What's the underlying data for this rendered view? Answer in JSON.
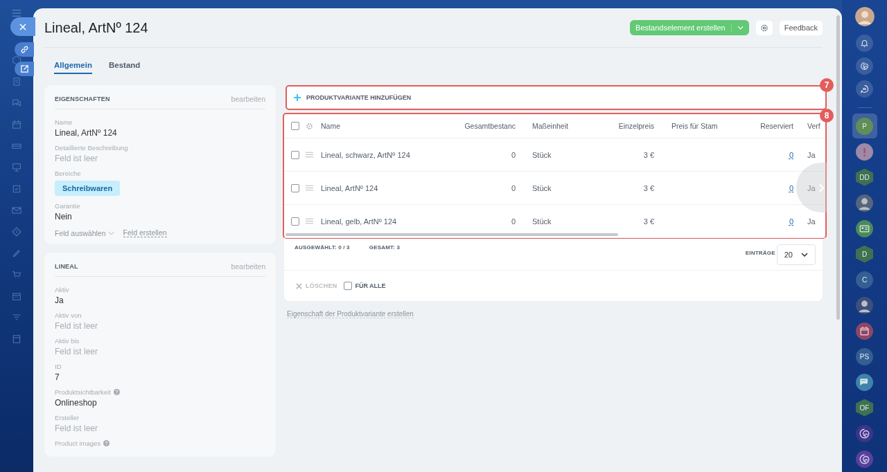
{
  "title": "Lineal, ArtNº 124",
  "header_buttons": {
    "create": "Bestandselement erstellen",
    "feedback": "Feedback"
  },
  "tabs": [
    {
      "label": "Allgemein",
      "selected": true
    },
    {
      "label": "Bestand",
      "selected": false
    }
  ],
  "cards": [
    {
      "title": "EIGENSCHAFTEN",
      "action": "bearbeiten",
      "fields": [
        {
          "label": "Name",
          "value": "Lineal, ArtNº 124",
          "empty": false
        },
        {
          "label": "Detaillierte Beschreibung",
          "value": "Feld ist leer",
          "empty": true
        },
        {
          "label": "Bereiche",
          "tag": "Schreibwaren"
        },
        {
          "label": "Garantie",
          "value": "Nein",
          "empty": false
        }
      ],
      "footer": {
        "select": "Feld auswählen",
        "create": "Feld erstellen"
      }
    },
    {
      "title": "LINEAL",
      "action": "bearbeiten",
      "fields": [
        {
          "label": "Aktiv",
          "value": "Ja",
          "empty": false
        },
        {
          "label": "Aktiv von",
          "value": "Feld ist leer",
          "empty": true
        },
        {
          "label": "Aktiv bis",
          "value": "Feld ist leer",
          "empty": true
        },
        {
          "label": "ID",
          "value": "7",
          "empty": false
        },
        {
          "label": "Produktsichtbarkeit",
          "value": "Onlineshop",
          "empty": false,
          "help": true
        },
        {
          "label": "Ersteller",
          "value": "Feld ist leer",
          "empty": true
        },
        {
          "label": "Product images",
          "help": true
        }
      ]
    }
  ],
  "add_variant": {
    "label": "PRODUKTVARIANTE HINZUFÜGEN",
    "marker": "7"
  },
  "table": {
    "marker": "8",
    "all_checked": false,
    "columns": [
      "Name",
      "Gesamtbestanc",
      "Maßeinheit",
      "Einzelpreis",
      "Preis für Stam",
      "Reserviert",
      "Verf"
    ],
    "rows": [
      {
        "checked": false,
        "cells": [
          "Lineal, schwarz, ArtNº 124",
          "0",
          "Stück",
          "3 €",
          "",
          "0",
          "Ja"
        ]
      },
      {
        "checked": false,
        "cells": [
          "Lineal, ArtNº 124",
          "0",
          "Stück",
          "3 €",
          "",
          "0",
          "Ja"
        ]
      },
      {
        "checked": false,
        "cells": [
          "Lineal, gelb, ArtNº 124",
          "0",
          "Stück",
          "3 €",
          "",
          "0",
          "Ja"
        ]
      }
    ]
  },
  "footer": {
    "selected": "AUSGEWÄHLT: **0 / 3**",
    "total": "GESAMT: **3**",
    "entries_label": "EINTRÄGE",
    "entries": "20",
    "delete": {
      "label": "LÖSCHEN",
      "disabled": true
    },
    "for_all": {
      "label": "FÜR ALLE",
      "checked": false
    }
  },
  "create_property_link": "Eigenschaft der Produktvariante erstellen",
  "chats": [
    {
      "kind": "letter",
      "text": "P",
      "color": "#5f8f57",
      "selected": true
    },
    {
      "kind": "alert",
      "color": "#9c8aa8",
      "selected": false
    },
    {
      "kind": "hex",
      "text": "DD",
      "color": "#3f7150",
      "selected": false
    },
    {
      "kind": "photo",
      "color": "#56657d",
      "selected": false
    },
    {
      "kind": "card",
      "color": "#4a8a5c",
      "selected": false
    },
    {
      "kind": "hex",
      "text": "D",
      "color": "#3f7150",
      "selected": false
    },
    {
      "kind": "letter",
      "text": "C",
      "color": "#345f92",
      "selected": false
    },
    {
      "kind": "photo",
      "color": "#3e4f7c",
      "selected": false
    },
    {
      "kind": "calendar",
      "color": "#8c4766",
      "selected": false
    },
    {
      "kind": "letter",
      "text": "PS",
      "color": "#345f92",
      "selected": false
    },
    {
      "kind": "chat",
      "color": "#3f82ac",
      "selected": false
    },
    {
      "kind": "hex",
      "text": "OF",
      "color": "#3f7150",
      "selected": false
    },
    {
      "kind": "spiral",
      "color": "#3d358a",
      "selected": false
    },
    {
      "kind": "spiral",
      "color": "#58409a",
      "selected": false
    }
  ]
}
